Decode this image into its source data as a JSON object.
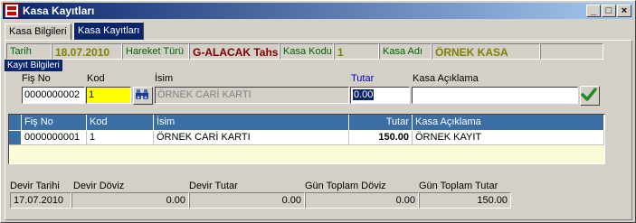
{
  "window": {
    "title": "Kasa Kayıtları",
    "minimize": "_",
    "maximize": "□",
    "close": "×"
  },
  "tabs": [
    "Kasa Bilgileri",
    "Kasa Kayıtları"
  ],
  "info_bar": {
    "date_label": "Tarih",
    "date_value": "18.07.2010",
    "movement_label": "Hareket Türü",
    "movement_value": "G-ALACAK Tahs",
    "code_label": "Kasa Kodu",
    "code_value": "1",
    "name_label": "Kasa Adı",
    "name_value": "ÖRNEK KASA"
  },
  "form": {
    "group_title": "Kayıt Bilgileri",
    "fis_no_label": "Fiş No",
    "fis_no_value": "0000000002",
    "kod_label": "Kod",
    "kod_value": "1",
    "isim_label": "İsim",
    "isim_value": "ÖRNEK CARİ KARTI",
    "tutar_label": "Tutar",
    "tutar_value": "0.00",
    "aciklama_label": "Kasa Açıklama",
    "aciklama_value": ""
  },
  "table": {
    "columns": [
      "Fiş No",
      "Kod",
      "İsim",
      "Tutar",
      "Kasa Açıklama"
    ],
    "rows": [
      {
        "fis_no": "0000000001",
        "kod": "1",
        "isim": "ÖRNEK CARİ KARTI",
        "tutar": "150.00",
        "aciklama": "ÖRNEK KAYIT"
      }
    ]
  },
  "summary": {
    "devir_tarihi_label": "Devir Tarihi",
    "devir_tarihi_value": "17.07.2010",
    "devir_doviz_label": "Devir Döviz",
    "devir_doviz_value": "0.00",
    "devir_tutar_label": "Devir Tutar",
    "devir_tutar_value": "0.00",
    "gun_doviz_label": "Gün Toplam Döviz",
    "gun_doviz_value": "0.00",
    "gun_tutar_label": "Gün Toplam Tutar",
    "gun_tutar_value": "150.00"
  },
  "colors": {
    "titlebar_start": "#0a246a",
    "titlebar_end": "#a6caf0",
    "grid_header": "#3a6ea5",
    "kod_highlight": "#ffff00",
    "tutar_highlight": "#a6caf0"
  }
}
